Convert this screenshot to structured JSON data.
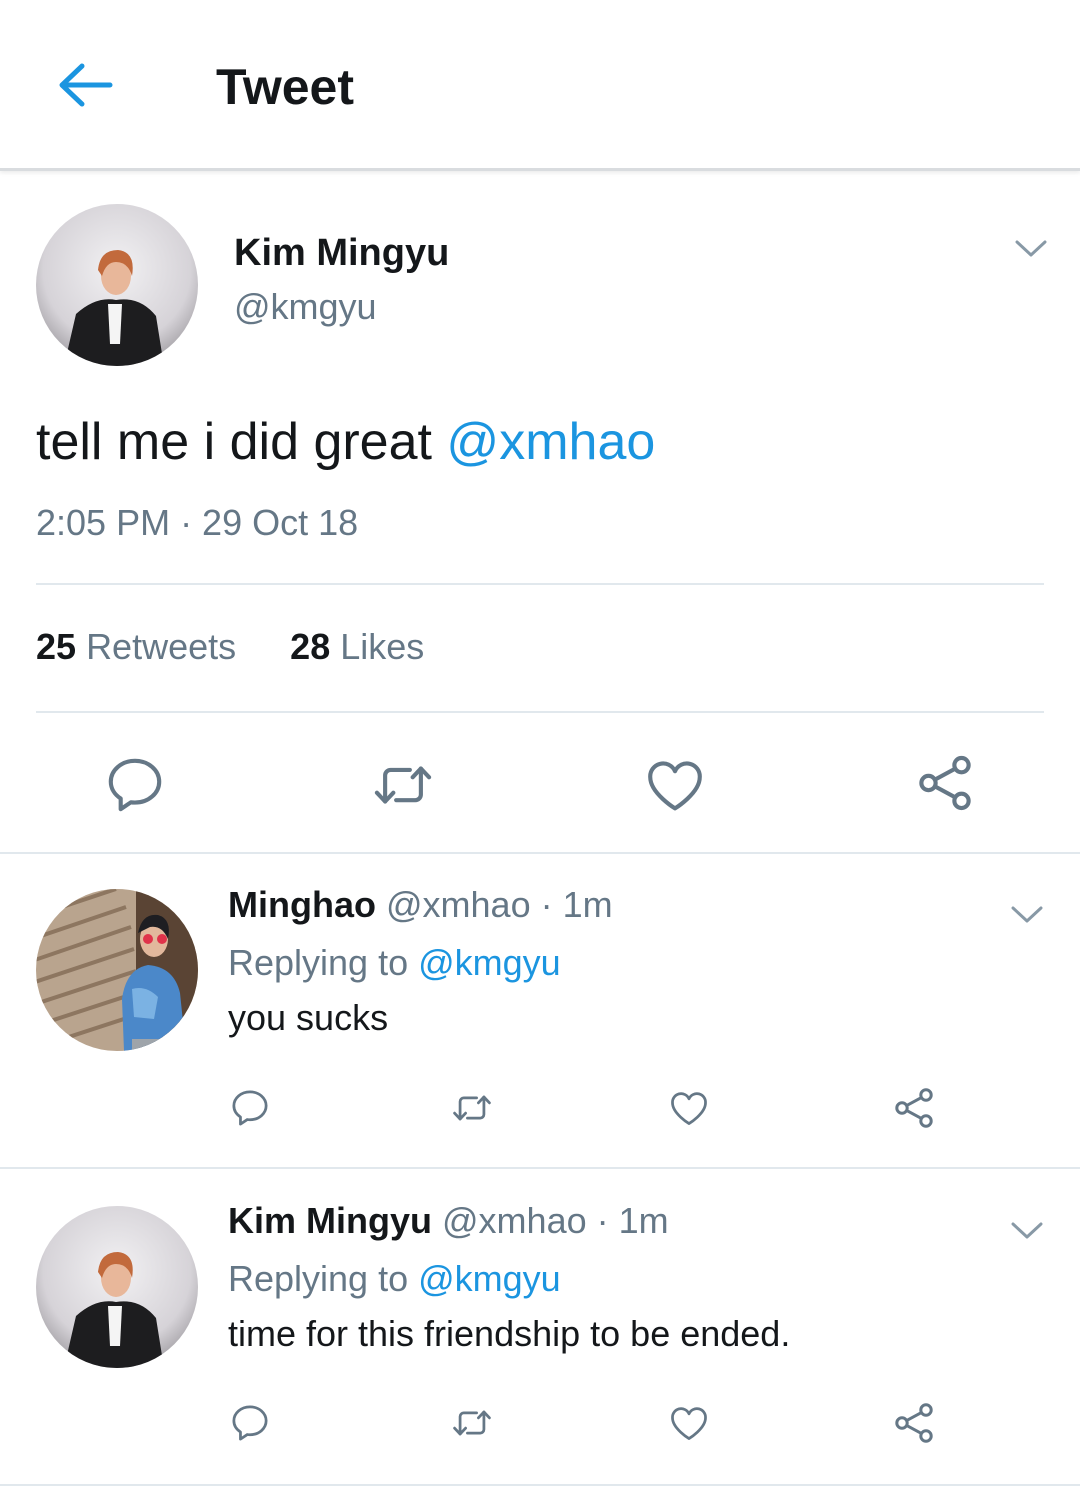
{
  "header": {
    "title": "Tweet"
  },
  "tweet": {
    "name": "Kim Mingyu",
    "handle": "@kmgyu",
    "text": "tell me i did great ",
    "mention": "@xmhao",
    "timestamp": "2:05 PM · 29 Oct 18",
    "retweets_count": "25",
    "retweets_label": "Retweets",
    "likes_count": "28",
    "likes_label": "Likes"
  },
  "replies": [
    {
      "name": "Minghao",
      "meta": "@xmhao · 1m",
      "replying_prefix": "Replying to ",
      "replying_handle": "@kmgyu",
      "text": "you sucks"
    },
    {
      "name": "Kim Mingyu",
      "meta": "@xmhao · 1m",
      "replying_prefix": "Replying to ",
      "replying_handle": "@kmgyu",
      "text": "time for this friendship to be ended."
    }
  ],
  "icons": [
    "back-arrow-icon",
    "chevron-down-icon",
    "reply-icon",
    "retweet-icon",
    "like-icon",
    "share-icon"
  ],
  "colors": {
    "accent": "#1b95e0",
    "muted": "#657786",
    "text": "#14171a",
    "divider": "#e1e8ed"
  }
}
